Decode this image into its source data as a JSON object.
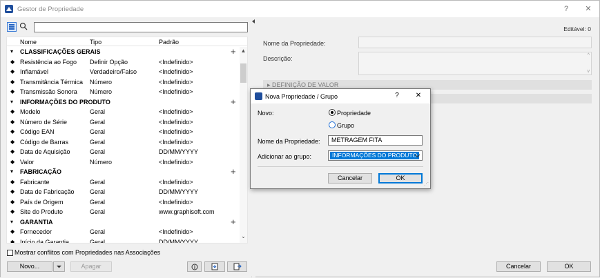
{
  "window": {
    "title": "Gestor de Propriedade",
    "help": "?",
    "close": "✕"
  },
  "left": {
    "columns": [
      "Nome",
      "Tipo",
      "Padrão"
    ],
    "rows": [
      {
        "kind": "group",
        "name": "CLASSIFICAÇÕES GERAIS",
        "type": "",
        "default": ""
      },
      {
        "kind": "item",
        "name": "Resistência ao Fogo",
        "type": "Definir Opção",
        "default": "<Indefinido>"
      },
      {
        "kind": "item",
        "name": "Inflamável",
        "type": "Verdadeiro/Falso",
        "default": "<Indefinido>"
      },
      {
        "kind": "item",
        "name": "Transmitância Térmica",
        "type": "Número",
        "default": "<Indefinido>"
      },
      {
        "kind": "item",
        "name": "Transmissão Sonora",
        "type": "Número",
        "default": "<Indefinido>"
      },
      {
        "kind": "group",
        "name": "INFORMAÇÕES DO PRODUTO",
        "type": "",
        "default": ""
      },
      {
        "kind": "item",
        "name": "Modelo",
        "type": "Geral",
        "default": "<Indefinido>"
      },
      {
        "kind": "item",
        "name": "Número de Série",
        "type": "Geral",
        "default": "<Indefinido>"
      },
      {
        "kind": "item",
        "name": "Código EAN",
        "type": "Geral",
        "default": "<Indefinido>"
      },
      {
        "kind": "item",
        "name": "Código de Barras",
        "type": "Geral",
        "default": "<Indefinido>"
      },
      {
        "kind": "item",
        "name": "Data de Aquisição",
        "type": "Geral",
        "default": "DD/MM/YYYY"
      },
      {
        "kind": "item",
        "name": "Valor",
        "type": "Número",
        "default": "<Indefinido>"
      },
      {
        "kind": "group",
        "name": "FABRICAÇÃO",
        "type": "",
        "default": ""
      },
      {
        "kind": "item",
        "name": "Fabricante",
        "type": "Geral",
        "default": "<Indefinido>"
      },
      {
        "kind": "item",
        "name": "Data de Fabricação",
        "type": "Geral",
        "default": "DD/MM/YYYY"
      },
      {
        "kind": "item",
        "name": "País de Origem",
        "type": "Geral",
        "default": "<Indefinido>"
      },
      {
        "kind": "item",
        "name": "Site do Produto",
        "type": "Geral",
        "default": "www.graphisoft.com"
      },
      {
        "kind": "group",
        "name": "GARANTIA",
        "type": "",
        "default": ""
      },
      {
        "kind": "item",
        "name": "Fornecedor",
        "type": "Geral",
        "default": "<Indefinido>"
      },
      {
        "kind": "item",
        "name": "Início da Garantia",
        "type": "Geral",
        "default": "DD/MM/YYYY"
      }
    ],
    "show_conflicts": "Mostrar conflitos com Propriedades nas Associações",
    "new_button": "Novo...",
    "delete_button": "Apagar"
  },
  "right": {
    "editable": "Editável: 0",
    "property_name_label": "Nome da Propriedade:",
    "description_label": "Descrição:",
    "value_definition": "DEFINIÇÃO DE VALOR",
    "cancel": "Cancelar",
    "ok": "OK"
  },
  "dialog": {
    "title": "Nova Propriedade / Grupo",
    "help": "?",
    "close": "✕",
    "new_label": "Novo:",
    "option_property": "Propriedade",
    "option_group": "Grupo",
    "name_label": "Nome da Propriedade:",
    "name_value": "METRAGEM FITA",
    "add_to_group_label": "Adicionar ao grupo:",
    "group_value": "INFORMAÇÕES DO PRODUTO",
    "cancel": "Cancelar",
    "ok": "OK"
  }
}
